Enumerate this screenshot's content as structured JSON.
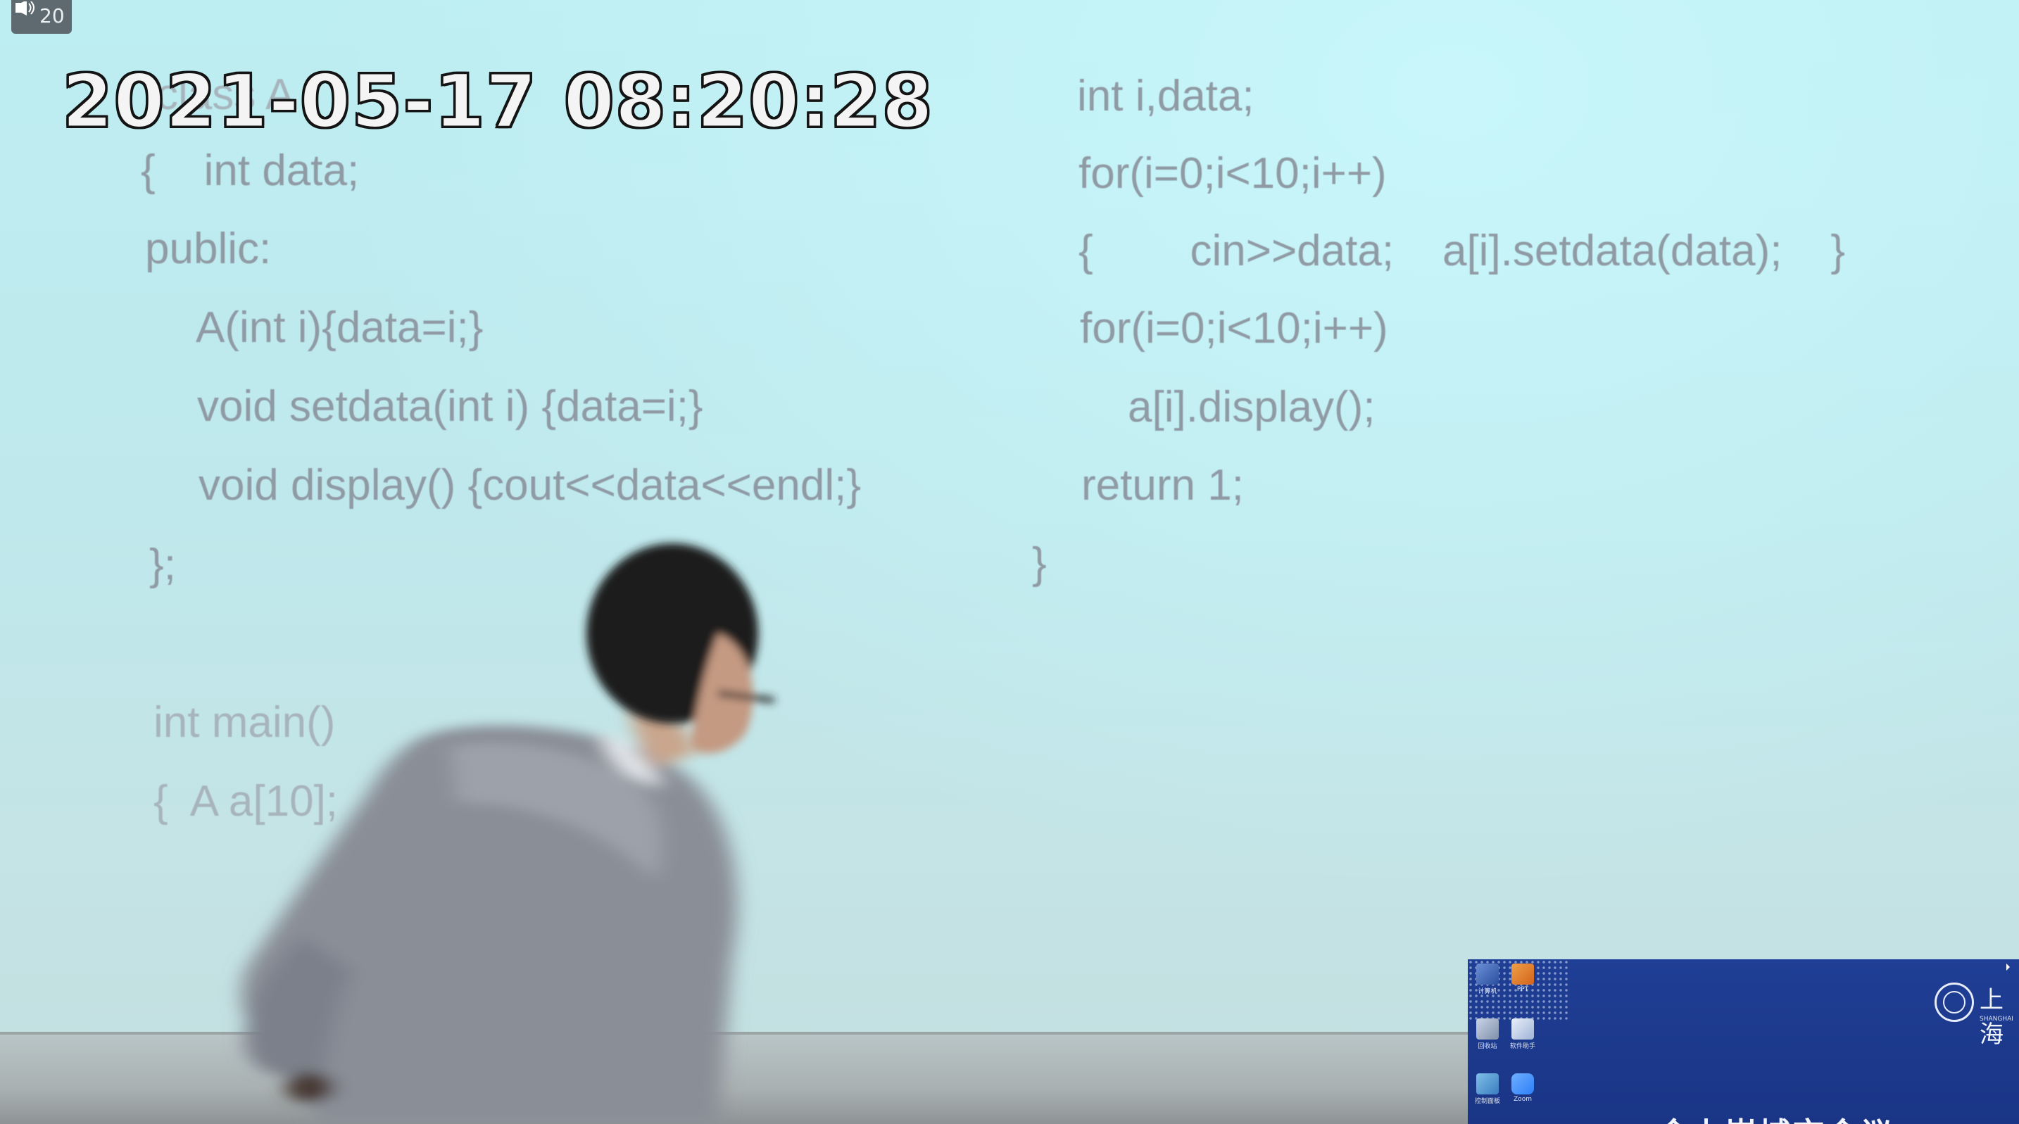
{
  "overlay": {
    "volume_label": "20",
    "timestamp": "2021-05-17  08:20:28"
  },
  "slide": {
    "left_column": [
      "class A",
      "{    int data;",
      "public:",
      "A(int i){data=i;}",
      "void setdata(int i) {data=i;}",
      "void display() {cout<<data<<endl;}",
      "};",
      "int main()",
      "{  A a[10];"
    ],
    "right_column": [
      "int i,data;",
      "for(i=0;i<10;i++)",
      "{        cin>>data;    a[i].setdata(data);    }",
      "for(i=0;i<10;i++)",
      "a[i].display();",
      "return 1;",
      "}"
    ]
  },
  "desktop": {
    "icons": [
      {
        "label": "计算机"
      },
      {
        "label": "PPT"
      },
      {
        "label": "回收站"
      },
      {
        "label": "软件助手"
      },
      {
        "label": "控制面板"
      },
      {
        "label": "Zoom"
      }
    ],
    "logo_text": "上海",
    "logo_sub": "SHANGHAI",
    "banner": "会上嵌城市会议"
  },
  "colors": {
    "screen": "#bfe9ee",
    "code_text": "#8f9aa4",
    "desktop_bg": "#1f3e95"
  }
}
